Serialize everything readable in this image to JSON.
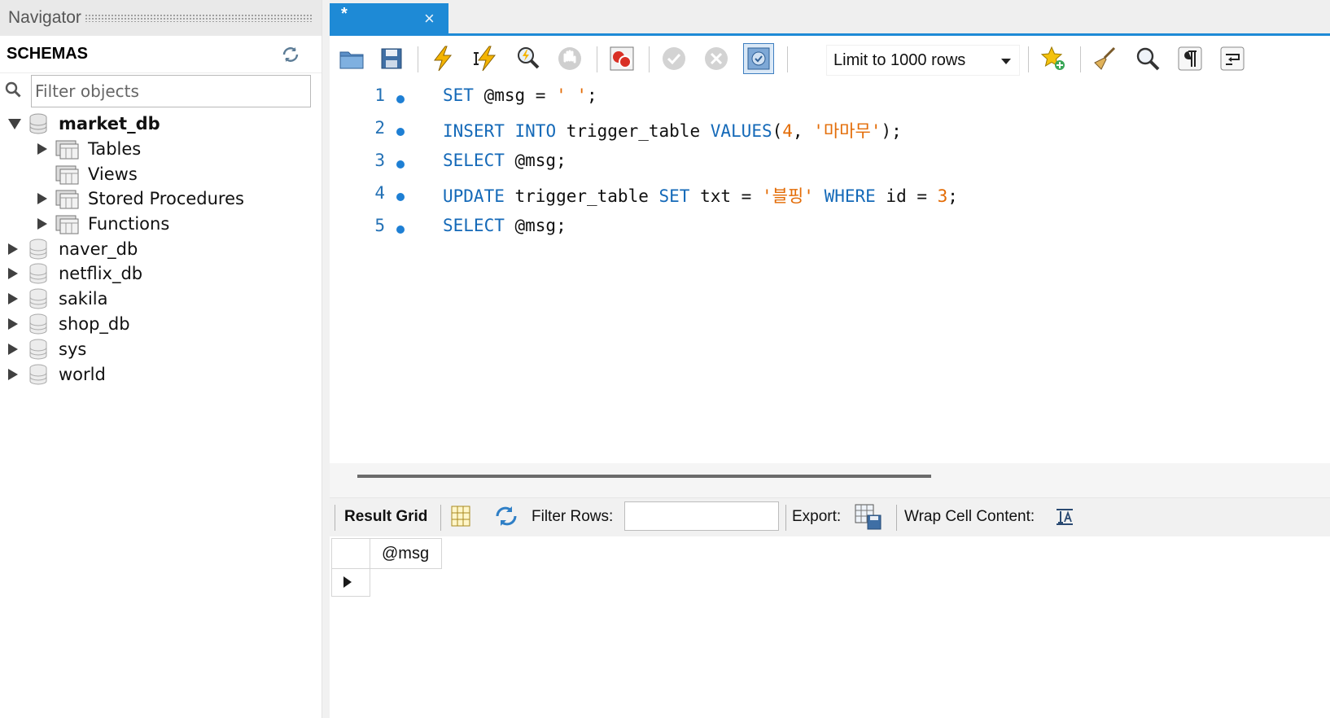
{
  "navigator": {
    "title": "Navigator",
    "schemas_label": "SCHEMAS",
    "filter_placeholder": "Filter objects",
    "tree": {
      "expanded_db": {
        "name": "market_db",
        "children": [
          "Tables",
          "Views",
          "Stored Procedures",
          "Functions"
        ]
      },
      "other_dbs": [
        "naver_db",
        "netflix_db",
        "sakila",
        "shop_db",
        "sys",
        "world"
      ]
    }
  },
  "editor": {
    "tab_title": "*",
    "tab_close": "×",
    "limit_label": "Limit to 1000 rows",
    "lines": [
      {
        "num": "1",
        "parts": [
          [
            "kw",
            "SET"
          ],
          [
            "t",
            " @msg = "
          ],
          [
            "str",
            "' '"
          ],
          [
            "t",
            ";"
          ]
        ]
      },
      {
        "num": "2",
        "parts": [
          [
            "kw",
            "INSERT"
          ],
          [
            "t",
            " "
          ],
          [
            "kw",
            "INTO"
          ],
          [
            "t",
            " trigger_table "
          ],
          [
            "kw",
            "VALUES"
          ],
          [
            "t",
            "("
          ],
          [
            "num",
            "4"
          ],
          [
            "t",
            ", "
          ],
          [
            "str",
            "'마마무'"
          ],
          [
            "t",
            ");"
          ]
        ]
      },
      {
        "num": "3",
        "parts": [
          [
            "kw",
            "SELECT"
          ],
          [
            "t",
            " @msg;"
          ]
        ]
      },
      {
        "num": "4",
        "parts": [
          [
            "kw",
            "UPDATE"
          ],
          [
            "t",
            " trigger_table "
          ],
          [
            "kw",
            "SET"
          ],
          [
            "t",
            " txt = "
          ],
          [
            "str",
            "'블핑'"
          ],
          [
            "t",
            " "
          ],
          [
            "kw",
            "WHERE"
          ],
          [
            "t",
            " id = "
          ],
          [
            "num",
            "3"
          ],
          [
            "t",
            ";"
          ]
        ]
      },
      {
        "num": "5",
        "parts": [
          [
            "kw",
            "SELECT"
          ],
          [
            "t",
            " @msg;"
          ]
        ]
      }
    ]
  },
  "result": {
    "result_grid_label": "Result Grid",
    "filter_rows_label": "Filter Rows:",
    "export_label": "Export:",
    "wrap_label": "Wrap Cell Content:",
    "column": "@msg"
  },
  "colors": {
    "accent": "#1e8ad6",
    "keyword": "#1469b8",
    "string": "#e36b05"
  }
}
